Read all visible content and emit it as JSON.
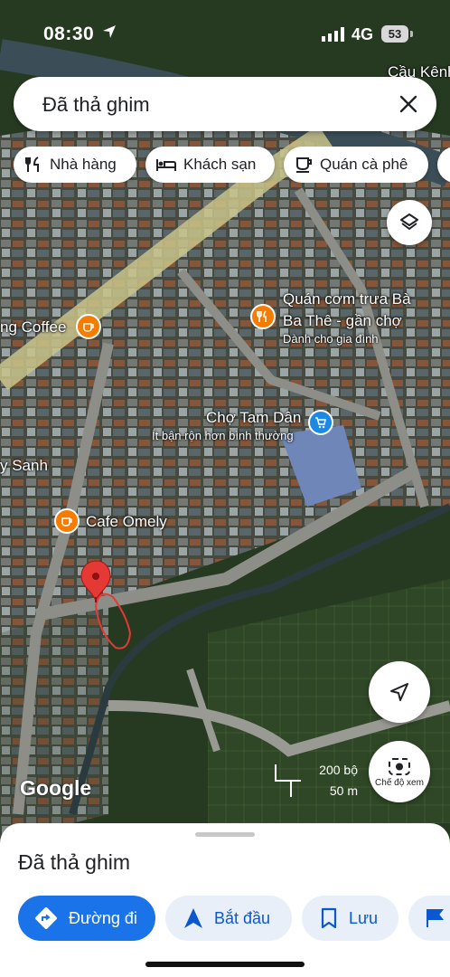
{
  "status_bar": {
    "time": "08:30",
    "network": "4G",
    "battery": "53"
  },
  "search": {
    "query": "Đã thả ghim"
  },
  "chips": [
    {
      "label": "Nhà hàng",
      "icon": "fork-knife-icon"
    },
    {
      "label": "Khách sạn",
      "icon": "bed-icon"
    },
    {
      "label": "Quán cà phê",
      "icon": "coffee-cup-icon"
    }
  ],
  "map": {
    "places": {
      "quan_com_line1": "Quán cơm trưa Bà",
      "quan_com_line2": "Ba Thê - gần chợ",
      "quan_com_sub": "Dành cho gia đình",
      "cho_name": "Chợ Tam Dân",
      "cho_sub": "Ít bận rộn hơn bình thường",
      "coffee_left": "ng Coffee",
      "sanh": "y Sanh",
      "cafe_omely": "Cafe Omely",
      "cau_kenh": "Cầu Kênh"
    },
    "attribution": "Google",
    "scale": {
      "imperial": "200 bộ",
      "metric": "50 m"
    },
    "lens_label": "Chế độ xem",
    "colors": {
      "pin": "#e53935",
      "food": "#f57c00",
      "shop": "#1e88e5"
    }
  },
  "sheet": {
    "title": "Đã thả ghim",
    "actions": {
      "directions": "Đường đi",
      "start": "Bắt đầu",
      "save": "Lưu"
    }
  }
}
